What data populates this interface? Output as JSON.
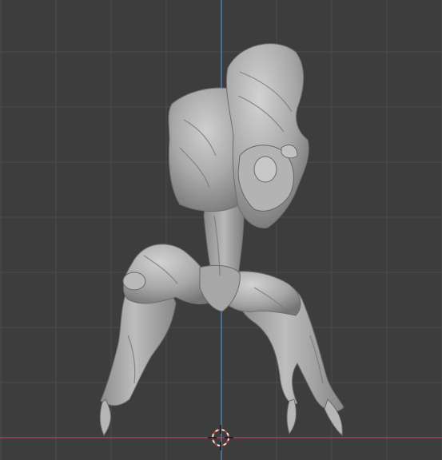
{
  "viewport": {
    "background_color": "#3d3d3d",
    "grid_minor_color": "#454545",
    "grid_major_color": "#4a4a4a",
    "z_axis_color": "#4f7fb0",
    "x_axis_color": "#a04553",
    "mesh_base_color": "#a9a9a9",
    "mesh_shadow_color": "#6a6a6a",
    "mesh_highlight_color": "#d0d0d0",
    "cursor_ring_colors": [
      "#e8e8e8",
      "#d03a3a"
    ]
  },
  "scene_objects": [
    {
      "name": "sculpted-creature",
      "type": "mesh",
      "shading": "solid"
    },
    {
      "name": "3d-cursor",
      "type": "cursor"
    }
  ],
  "icons": {
    "cursor": "3d-cursor-icon"
  }
}
